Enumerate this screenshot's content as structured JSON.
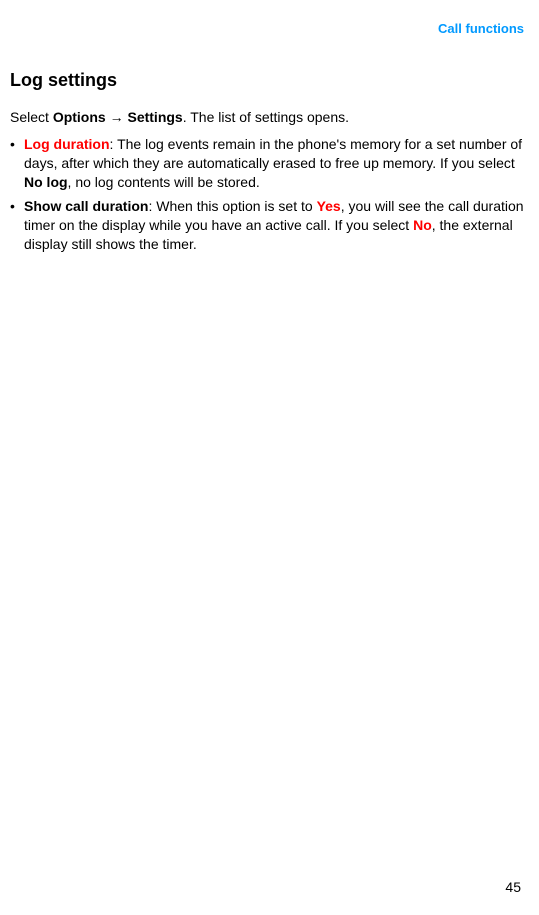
{
  "header": {
    "section_label": "Call functions"
  },
  "title": "Log settings",
  "intro": {
    "prefix": "Select ",
    "options_word": "Options",
    "arrow": " → ",
    "settings_word": "Settings",
    "suffix": ". The list of settings opens."
  },
  "bullets": [
    {
      "mark": "•",
      "label": "Log duration",
      "label_red": true,
      "text_before_bold": ": The log events remain in the phone's memory for a set number of days, after which they are automatically erased to free up memory. If you select ",
      "inner_bold": "No log",
      "text_after_bold": ", no log contents will be stored."
    },
    {
      "mark": "•",
      "label": "Show call duration",
      "label_red": false,
      "text_before_bold": ": When this option is set to ",
      "inner_bold": "Yes",
      "inner_bold_red": true,
      "text_mid": ", you will see the call duration timer on the display while you have an active call. If you select ",
      "inner_bold2": "No",
      "inner_bold2_red": true,
      "text_after_bold": ", the external display still shows the timer."
    }
  ],
  "page_number": "45"
}
